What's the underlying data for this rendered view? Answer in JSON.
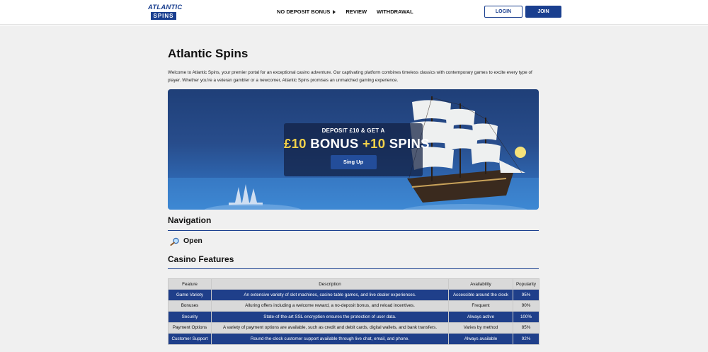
{
  "header": {
    "logo": {
      "line1": "ATLANTIC",
      "line2": "SPINS"
    },
    "nav": [
      {
        "label": "NO DEPOSIT BONUS",
        "has_caret": true
      },
      {
        "label": "REVIEW",
        "has_caret": false
      },
      {
        "label": "WITHDRAWAL",
        "has_caret": false
      }
    ],
    "login_label": "LOGIN",
    "join_label": "JOIN"
  },
  "main": {
    "title": "Atlantic Spins",
    "intro": "Welcome to Atlantic Spins, your premier portal for an exceptional casino adventure. Our captivating platform combines timeless classics with contemporary games to excite every type of player. Whether you're a veteran gambler or a newcomer, Atlantic Spins promises an unmatched gaming experience."
  },
  "banner": {
    "top_line": "DEPOSIT £10 & GET A",
    "amount": "£10",
    "bonus_word": "BONUS",
    "plus_spins": "+10",
    "spins_word": "SPINS",
    "button_label": "Sing Up"
  },
  "navigation": {
    "heading": "Navigation",
    "open_label": "Open",
    "icon": "magnifier-icon"
  },
  "features": {
    "heading": "Casino Features",
    "columns": [
      "Feature",
      "Description",
      "Availability",
      "Popularity"
    ],
    "rows": [
      {
        "feature": "Game Variety",
        "description": "An extensive variety of slot machines, casino table games, and live dealer experiences.",
        "availability": "Accessible around the clock",
        "popularity": "95%"
      },
      {
        "feature": "Bonuses",
        "description": "Alluring offers including a welcome reward, a no-deposit bonus, and reload incentives.",
        "availability": "Frequent",
        "popularity": "90%"
      },
      {
        "feature": "Security",
        "description": "State-of-the-art SSL encryption ensures the protection of user data.",
        "availability": "Always active",
        "popularity": "100%"
      },
      {
        "feature": "Payment Options",
        "description": "A variety of payment options are available, such as credit and debit cards, digital wallets, and bank transfers.",
        "availability": "Varies by method",
        "popularity": "85%"
      },
      {
        "feature": "Customer Support",
        "description": "Round-the-clock customer support available through live chat, email, and phone.",
        "availability": "Always available",
        "popularity": "92%"
      }
    ]
  },
  "colors": {
    "brand_blue": "#1a3f8f",
    "table_dark_row": "#1f3f8a",
    "table_light_row": "#d9d9d9",
    "promo_yellow": "#f3d24a"
  }
}
